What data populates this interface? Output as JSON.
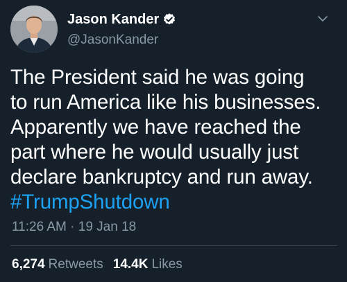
{
  "author": {
    "display_name": "Jason Kander",
    "handle": "@JasonKander",
    "verified": true
  },
  "tweet": {
    "lines": [
      "The President said he was going",
      "to run America like his businesses.",
      "Apparently we have reached the",
      "part where he would usually just",
      "declare bankruptcy and run away."
    ],
    "hashtag": "#TrumpShutdown",
    "time": "11:26 AM",
    "separator": "·",
    "date": "19 Jan 18"
  },
  "stats": {
    "retweets_count": "6,274",
    "retweets_label": "Retweets",
    "likes_count": "14.4K",
    "likes_label": "Likes"
  },
  "colors": {
    "background": "#15202b",
    "text": "#ffffff",
    "muted": "#8899a6",
    "link": "#1da1f2",
    "divider": "#38444d"
  },
  "icons": {
    "verified": "verified-badge-icon",
    "menu": "chevron-down-icon"
  }
}
